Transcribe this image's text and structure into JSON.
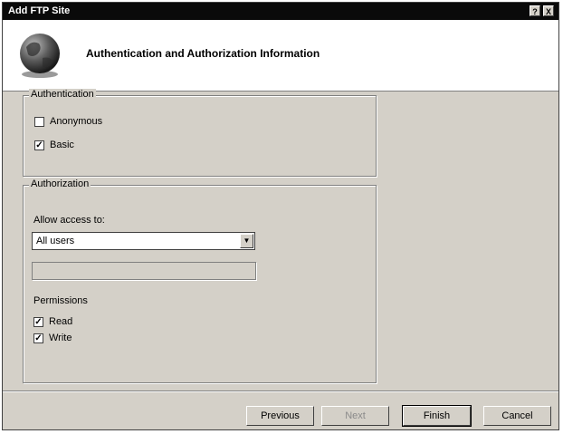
{
  "window": {
    "title": "Add FTP Site",
    "help_button": "?",
    "close_button": "X"
  },
  "header": {
    "title": "Authentication and Authorization Information",
    "icon": "globe-icon"
  },
  "authentication": {
    "legend": "Authentication",
    "anonymous_label": "Anonymous",
    "anonymous_checked": "",
    "basic_label": "Basic",
    "basic_checked": "✓"
  },
  "authorization": {
    "legend": "Authorization",
    "allow_access_label": "Allow access to:",
    "allow_access_value": "All users",
    "select_arrow": "▼",
    "permissions_label": "Permissions",
    "read_label": "Read",
    "read_checked": "✓",
    "write_label": "Write",
    "write_checked": "✓"
  },
  "footer": {
    "previous": "Previous",
    "next": "Next",
    "finish": "Finish",
    "cancel": "Cancel"
  }
}
